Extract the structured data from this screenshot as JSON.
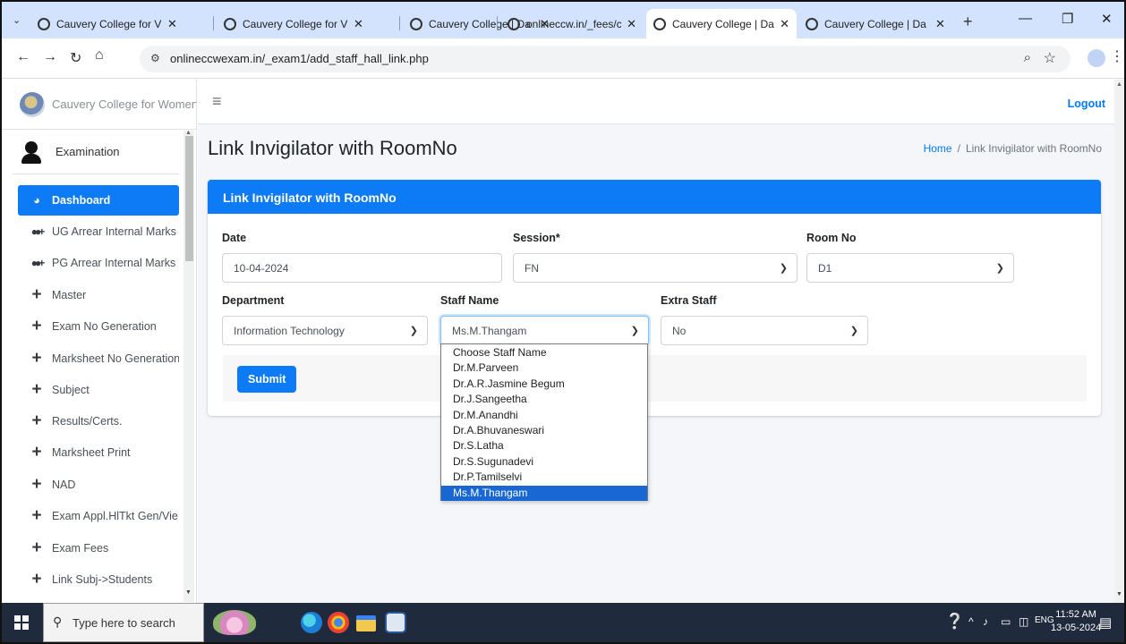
{
  "browser": {
    "tabs": [
      {
        "title": "Cauvery College for V",
        "active": false
      },
      {
        "title": "Cauvery College for V",
        "active": false
      },
      {
        "title": "Cauvery College | Da",
        "active": false
      },
      {
        "title": "onlineccw.in/_fees/cc",
        "active": false
      },
      {
        "title": "Cauvery College | Da",
        "active": true
      },
      {
        "title": "Cauvery College | Da",
        "active": false
      }
    ],
    "url": "onlineccwexam.in/_exam1/add_staff_hall_link.php"
  },
  "sidebar": {
    "brand": "Cauvery College for Women",
    "user": "Examination",
    "items": [
      {
        "label": "Dashboard",
        "icon": "dashboard-icon",
        "active": true
      },
      {
        "label": "UG Arrear Internal Marks",
        "icon": "users-plus-icon"
      },
      {
        "label": "PG Arrear Internal Marks",
        "icon": "users-plus-icon"
      },
      {
        "label": "Master",
        "icon": "plus-icon"
      },
      {
        "label": "Exam No Generation",
        "icon": "plus-icon"
      },
      {
        "label": "Marksheet No Generation",
        "icon": "plus-icon"
      },
      {
        "label": "Subject",
        "icon": "plus-icon"
      },
      {
        "label": "Results/Certs.",
        "icon": "plus-icon"
      },
      {
        "label": "Marksheet Print",
        "icon": "plus-icon"
      },
      {
        "label": "NAD",
        "icon": "plus-icon"
      },
      {
        "label": "Exam Appl.HlTkt Gen/Vie",
        "icon": "plus-icon"
      },
      {
        "label": "Exam Fees",
        "icon": "plus-icon"
      },
      {
        "label": "Link Subj->Students",
        "icon": "plus-icon"
      }
    ]
  },
  "topnav": {
    "logout": "Logout"
  },
  "page": {
    "title": "Link Invigilator with RoomNo",
    "breadcrumb": {
      "home": "Home",
      "current": "Link Invigilator with RoomNo"
    }
  },
  "form": {
    "card_title": "Link Invigilator with RoomNo",
    "date_label": "Date",
    "date_value": "10-04-2024",
    "session_label": "Session*",
    "session_value": "FN",
    "room_label": "Room No",
    "room_value": "D1",
    "department_label": "Department",
    "department_value": "Information Technology",
    "staff_label": "Staff Name",
    "staff_value": "Ms.M.Thangam",
    "extra_label": "Extra Staff",
    "extra_value": "No",
    "submit": "Submit"
  },
  "staff_options": [
    "Choose Staff Name",
    "Dr.M.Parveen",
    "Dr.A.R.Jasmine Begum",
    "Dr.J.Sangeetha",
    "Dr.M.Anandhi",
    "Dr.A.Bhuvaneswari",
    "Dr.S.Latha",
    "Dr.S.Sugunadevi",
    "Dr.P.Tamilselvi",
    "Ms.M.Thangam"
  ],
  "staff_selected_index": 9,
  "taskbar": {
    "search_placeholder": "Type here to search",
    "lang": "ENG",
    "time": "11:52 AM",
    "date": "13-05-2024"
  },
  "colors": {
    "primary": "#0d7bf5",
    "selected_option": "#1967d2",
    "taskbar": "#1f2a3c"
  }
}
